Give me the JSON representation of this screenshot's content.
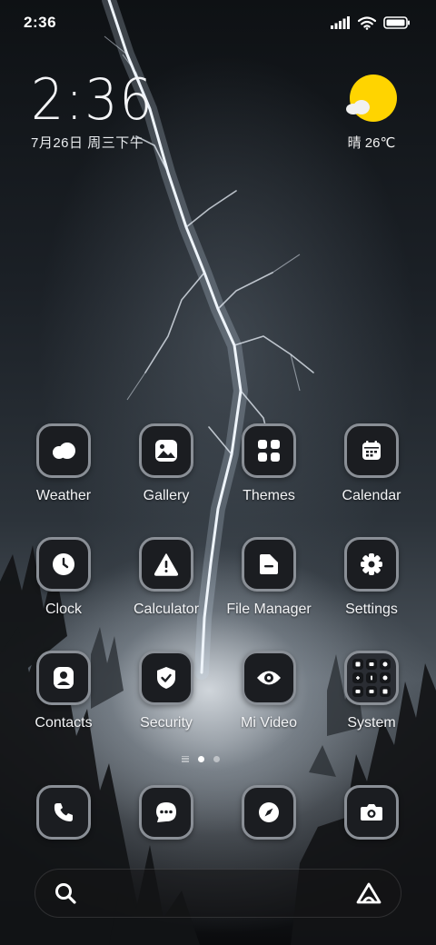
{
  "status_bar": {
    "time": "2:36",
    "icons": [
      "signal-icon",
      "wifi-icon",
      "battery-icon"
    ]
  },
  "clock_widget": {
    "time": "2:36",
    "date": "7月26日 周三下午"
  },
  "weather_widget": {
    "icon": "sunny-partly-cloudy-icon",
    "text": "晴 26℃"
  },
  "apps": [
    {
      "label": "Weather",
      "icon": "cloud-icon"
    },
    {
      "label": "Gallery",
      "icon": "image-icon"
    },
    {
      "label": "Themes",
      "icon": "grid-icon"
    },
    {
      "label": "Calendar",
      "icon": "calendar-icon"
    },
    {
      "label": "Clock",
      "icon": "clock-icon"
    },
    {
      "label": "Calculator",
      "icon": "warning-icon"
    },
    {
      "label": "File Manager",
      "icon": "folder-icon"
    },
    {
      "label": "Settings",
      "icon": "gear-icon"
    },
    {
      "label": "Contacts",
      "icon": "person-icon"
    },
    {
      "label": "Security",
      "icon": "shield-check-icon"
    },
    {
      "label": "Mi Video",
      "icon": "eye-icon"
    },
    {
      "label": "System",
      "icon": "folder-grid-icon"
    }
  ],
  "page_indicator": {
    "pages": 2,
    "current": 1
  },
  "dock": [
    {
      "name": "phone",
      "icon": "phone-icon"
    },
    {
      "name": "messages",
      "icon": "chat-icon"
    },
    {
      "name": "browser",
      "icon": "compass-icon"
    },
    {
      "name": "camera",
      "icon": "camera-icon"
    }
  ],
  "search_bar": {
    "left_icon": "search-icon",
    "right_icon": "assistant-icon"
  },
  "colors": {
    "sun": "#ffd400",
    "icon_bg": "#1b1d21",
    "icon_border": "#8a8f96"
  }
}
